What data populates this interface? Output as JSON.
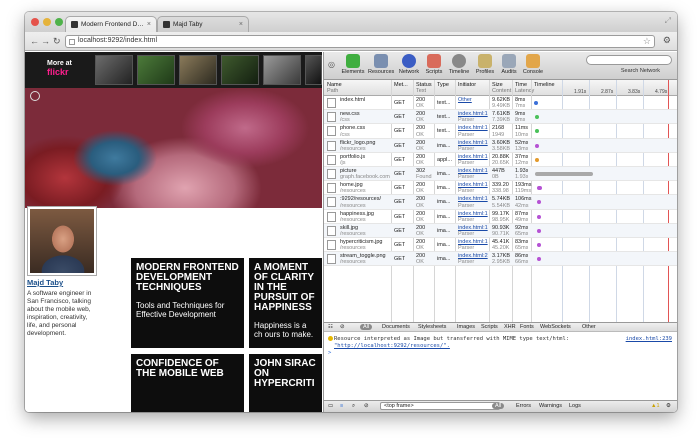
{
  "browser": {
    "tabs": [
      {
        "title": "Modern Frontend Developm"
      },
      {
        "title": "Majd Taby"
      }
    ],
    "url": "localhost:9292/index.html",
    "nav": {
      "back": "←",
      "forward": "→",
      "reload": "↻",
      "star": "☆",
      "wrench": "🔧"
    }
  },
  "page": {
    "flickr_label_top": "More at",
    "flickr_brand": "flickr",
    "person_name": "Majd Taby",
    "person_bio": "A software engineer in San Francisco, talking about the mobile web, inspiration, creativity, life, and personal development.",
    "cards": [
      {
        "title": "MODERN FRONTEND DEVELOPMENT TECHNIQUES",
        "subtitle": "Tools and Techniques for Effective Development"
      },
      {
        "title": "A MOMENT OF CLARITY IN THE PURSUIT OF HAPPINESS",
        "subtitle": "Happiness is a ch ours to make."
      },
      {
        "title": "CONFIDENCE OF THE MOBILE WEB",
        "subtitle": ""
      },
      {
        "title": "JOHN SIRAC ON HYPERCRITI",
        "subtitle": ""
      }
    ]
  },
  "devtools": {
    "tools": [
      "Elements",
      "Resources",
      "Network",
      "Scripts",
      "Timeline",
      "Profiles",
      "Audits",
      "Console"
    ],
    "search_label": "Search Network",
    "columns": {
      "name": "Name",
      "name_sub": "Path",
      "method": "Met...",
      "status": "Status",
      "status_sub": "Text",
      "type": "Type",
      "initiator": "Initiator",
      "size": "Size",
      "size_sub": "Content",
      "time": "Time",
      "time_sub": "Latency",
      "timeline": "Timeline"
    },
    "ticks": [
      "1.91s",
      "2.87s",
      "3.83s",
      "4.79s"
    ],
    "rows": [
      {
        "name": "index.html",
        "path": "",
        "method": "GET",
        "status": "200",
        "status_text": "OK",
        "type": "text...",
        "initiator": "Other",
        "initiator_sub": "",
        "size": "9.62KB",
        "content": "9.49KB",
        "time": "8ms",
        "latency": "7ms",
        "bar_color": "#3b6fd8",
        "bar_start": 0.0,
        "bar_end": 0.01
      },
      {
        "name": "new.css",
        "path": "/css",
        "method": "GET",
        "status": "200",
        "status_text": "OK",
        "type": "text...",
        "initiator": "index.html:1",
        "initiator_sub": "Parser",
        "size": "7.61KB",
        "content": "7.39KB",
        "time": "9ms",
        "latency": "8ms",
        "bar_color": "#4ac15a",
        "bar_start": 0.01,
        "bar_end": 0.02
      },
      {
        "name": "phone.css",
        "path": "/css",
        "method": "GET",
        "status": "200",
        "status_text": "OK",
        "type": "text...",
        "initiator": "index.html:1",
        "initiator_sub": "Parser",
        "size": "2168",
        "content": "1949",
        "time": "11ms",
        "latency": "10ms",
        "bar_color": "#4ac15a",
        "bar_start": 0.01,
        "bar_end": 0.02
      },
      {
        "name": "flickr_logo.png",
        "path": "/resources",
        "method": "GET",
        "status": "200",
        "status_text": "OK",
        "type": "ima...",
        "initiator": "index.html:1",
        "initiator_sub": "Parser",
        "size": "3.60KB",
        "content": "3.58KB",
        "time": "52ms",
        "latency": "13ms",
        "bar_color": "#b552d4",
        "bar_start": 0.01,
        "bar_end": 0.03
      },
      {
        "name": "portfolio.js",
        "path": "/js",
        "method": "GET",
        "status": "200",
        "status_text": "OK",
        "type": "appl...",
        "initiator": "index.html:1",
        "initiator_sub": "Parser",
        "size": "20.88K",
        "content": "20.65K",
        "time": "37ms",
        "latency": "12ms",
        "bar_color": "#e39a2c",
        "bar_start": 0.01,
        "bar_end": 0.03
      },
      {
        "name": "picture",
        "path": "graph.facebook.com",
        "method": "GET",
        "status": "302",
        "status_text": "Found",
        "type": "ima...",
        "initiator": "index.html:1",
        "initiator_sub": "Parser",
        "size": "447B",
        "content": "0B",
        "time": "1.93s",
        "latency": "1.93s",
        "bar_color": "#a9a9a9",
        "bar_start": 0.01,
        "bar_end": 0.42
      },
      {
        "name": "home.jpg",
        "path": "/resources",
        "method": "GET",
        "status": "200",
        "status_text": "OK",
        "type": "ima...",
        "initiator": "index.html:1",
        "initiator_sub": "Parser",
        "size": "339.20",
        "content": "338.98",
        "time": "193ms",
        "latency": "119ms",
        "bar_color": "#b552d4",
        "bar_start": 0.02,
        "bar_end": 0.06
      },
      {
        "name": ":9292/resources/",
        "path": "/resources",
        "method": "GET",
        "status": "200",
        "status_text": "OK",
        "type": "ima...",
        "initiator": "index.html:1",
        "initiator_sub": "Parser",
        "size": "5.74KB",
        "content": "5.54KB",
        "time": "106ms",
        "latency": "42ms",
        "bar_color": "#b552d4",
        "bar_start": 0.02,
        "bar_end": 0.05
      },
      {
        "name": "happiness.jpg",
        "path": "/resources",
        "method": "GET",
        "status": "200",
        "status_text": "OK",
        "type": "ima...",
        "initiator": "index.html:1",
        "initiator_sub": "Parser",
        "size": "99.17K",
        "content": "98.95K",
        "time": "87ms",
        "latency": "49ms",
        "bar_color": "#b552d4",
        "bar_start": 0.02,
        "bar_end": 0.05
      },
      {
        "name": "skill.jpg",
        "path": "/resources",
        "method": "GET",
        "status": "200",
        "status_text": "OK",
        "type": "ima...",
        "initiator": "index.html:1",
        "initiator_sub": "Parser",
        "size": "90.93K",
        "content": "90.71K",
        "time": "92ms",
        "latency": "65ms",
        "bar_color": "#b552d4",
        "bar_start": 0.02,
        "bar_end": 0.05
      },
      {
        "name": "hypercriticism.jpg",
        "path": "/resources",
        "method": "GET",
        "status": "200",
        "status_text": "OK",
        "type": "ima...",
        "initiator": "index.html:1",
        "initiator_sub": "Parser",
        "size": "45.41K",
        "content": "45.20K",
        "time": "83ms",
        "latency": "65ms",
        "bar_color": "#b552d4",
        "bar_start": 0.02,
        "bar_end": 0.05
      },
      {
        "name": "stream_toggle.png",
        "path": "/resources",
        "method": "GET",
        "status": "200",
        "status_text": "OK",
        "type": "ima...",
        "initiator": "index.html:2",
        "initiator_sub": "Parser",
        "size": "3.17KB",
        "content": "2.95KB",
        "time": "86ms",
        "latency": "66ms",
        "bar_color": "#b552d4",
        "bar_start": 0.02,
        "bar_end": 0.05
      }
    ],
    "filters": [
      "All",
      "Documents",
      "Stylesheets",
      "Images",
      "Scripts",
      "XHR",
      "Fonts",
      "WebSockets",
      "Other"
    ],
    "console_message": "Resource interpreted as Image but transferred with MIME type text/html:",
    "console_url": "\"http://localhost:9292/resources/\".",
    "console_source": "index.html:239",
    "frame_select": "<top frame>",
    "status_filters": [
      "All",
      "Errors",
      "Warnings",
      "Logs"
    ],
    "warning_count": "1",
    "prompt": ">"
  }
}
